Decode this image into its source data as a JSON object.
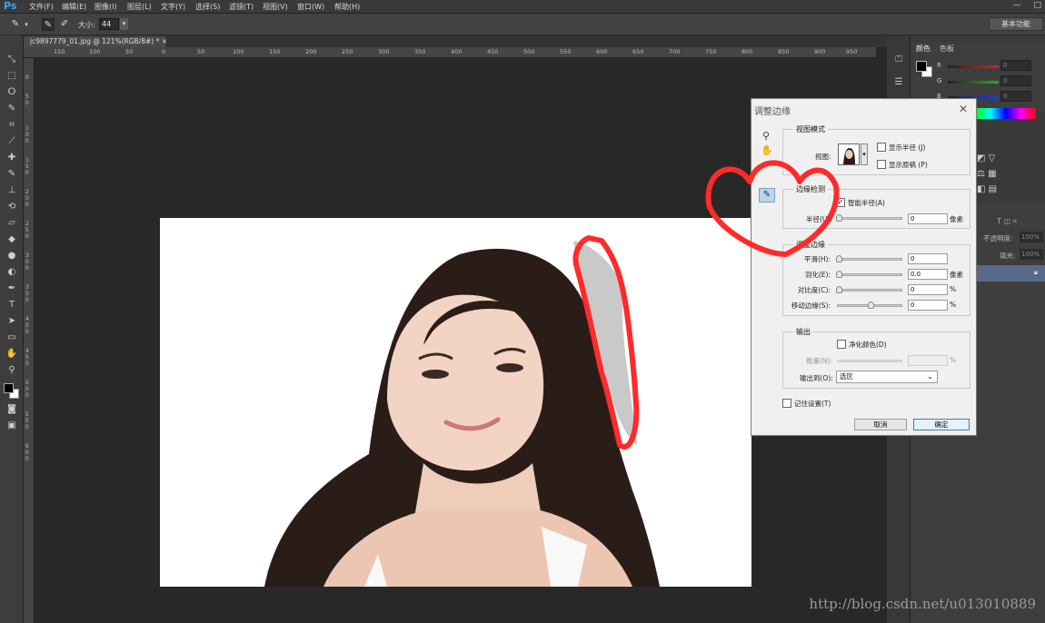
{
  "app": {
    "logo": "Ps"
  },
  "menu": [
    "文件(F)",
    "编辑(E)",
    "图像(I)",
    "图层(L)",
    "文字(Y)",
    "选择(S)",
    "滤镜(T)",
    "视图(V)",
    "窗口(W)",
    "帮助(H)"
  ],
  "window_controls": [
    "—",
    "□"
  ],
  "options": {
    "size_label": "大小:",
    "size_value": "44",
    "workspace": "基本功能"
  },
  "document_tab": "jc9897779_01.jpg @ 121%(RGB/8#) * ×",
  "ruler_h_ticks": [
    "150",
    "100",
    "50",
    "0",
    "50",
    "100",
    "150",
    "200",
    "250",
    "300",
    "350",
    "400",
    "450",
    "500",
    "550",
    "600",
    "650",
    "700",
    "750",
    "800",
    "850",
    "900",
    "950"
  ],
  "ruler_v_ticks": [
    "0",
    "5",
    "0",
    "1",
    "0",
    "0",
    "1",
    "5",
    "0",
    "2",
    "0",
    "0",
    "2",
    "5",
    "0",
    "3",
    "0",
    "0",
    "3",
    "5",
    "0",
    "4",
    "0",
    "0",
    "4",
    "5",
    "0",
    "5",
    "0",
    "0",
    "5",
    "5",
    "0",
    "6",
    "0",
    "0"
  ],
  "panel": {
    "tabs": [
      "颜色",
      "色板"
    ],
    "channels": [
      {
        "label": "R",
        "value": "0",
        "color": "#e02020"
      },
      {
        "label": "G",
        "value": "0",
        "color": "#20b020"
      },
      {
        "label": "B",
        "value": "0",
        "color": "#2040e0"
      }
    ],
    "layers": {
      "opacity_label": "不透明度:",
      "opacity_value": "100%",
      "fill_label": "填充:",
      "fill_value": "100%"
    }
  },
  "dialog": {
    "title": "调整边缘",
    "close": "✕",
    "view_mode": {
      "group": "视图模式",
      "view_label": "视图:",
      "show_radius": "显示半径 (J)",
      "show_original": "显示原稿 (P)"
    },
    "edge_detection": {
      "group": "边缘检测",
      "smart_radius": "智能半径(A)",
      "smart_radius_checked": true,
      "radius_label": "半径(U):",
      "radius_value": "0",
      "unit": "像素"
    },
    "adjust_edge": {
      "group": "调整边缘",
      "rows": [
        {
          "label": "平滑(H):",
          "value": "0",
          "unit": ""
        },
        {
          "label": "羽化(E):",
          "value": "0.0",
          "unit": "像素"
        },
        {
          "label": "对比度(C):",
          "value": "0",
          "unit": "%"
        },
        {
          "label": "移动边缘(S):",
          "value": "0",
          "unit": "%"
        }
      ]
    },
    "output": {
      "group": "输出",
      "decontaminate": "净化颜色(D)",
      "amount_label": "数量(N):",
      "amount_unit": "%",
      "output_to_label": "输出到(O):",
      "output_to_value": "选区"
    },
    "remember": "记住设置(T)",
    "cancel": "取消",
    "ok": "确定"
  },
  "watermark": "http://blog.csdn.net/u013010889",
  "colors": {
    "annotation": "#ff2a2a",
    "ps_blue": "#31a8ff",
    "layer_selected": "#586a87"
  }
}
